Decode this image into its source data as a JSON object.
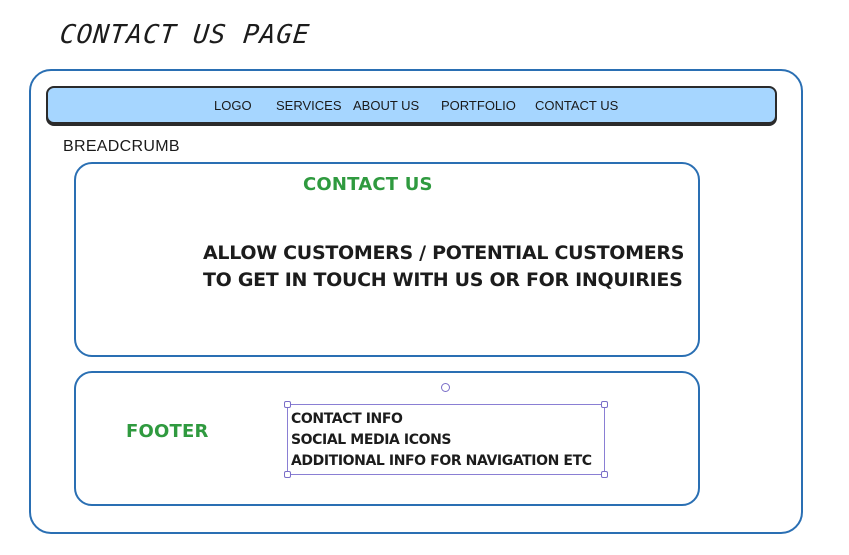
{
  "title": "CONTACT US PAGE",
  "nav": {
    "items": [
      {
        "label": "LOGO"
      },
      {
        "label": "SERVICES"
      },
      {
        "label": "ABOUT US"
      },
      {
        "label": "PORTFOLIO"
      },
      {
        "label": "CONTACT US"
      }
    ]
  },
  "breadcrumb": "BREADCRUMB",
  "contact_section": {
    "heading": "CONTACT US",
    "description_line1": "ALLOW CUSTOMERS / POTENTIAL CUSTOMERS",
    "description_line2": "TO GET IN TOUCH WITH US OR FOR INQUIRIES"
  },
  "footer_section": {
    "heading": "FOOTER",
    "lines": [
      "CONTACT INFO",
      "SOCIAL MEDIA ICONS",
      "ADDITIONAL INFO FOR NAVIGATION ETC"
    ]
  },
  "colors": {
    "frame_border": "#2a6fb3",
    "navbar_fill": "#a6d6ff",
    "heading_green": "#2f9a3f",
    "selection_purple": "#8a7fd4"
  }
}
